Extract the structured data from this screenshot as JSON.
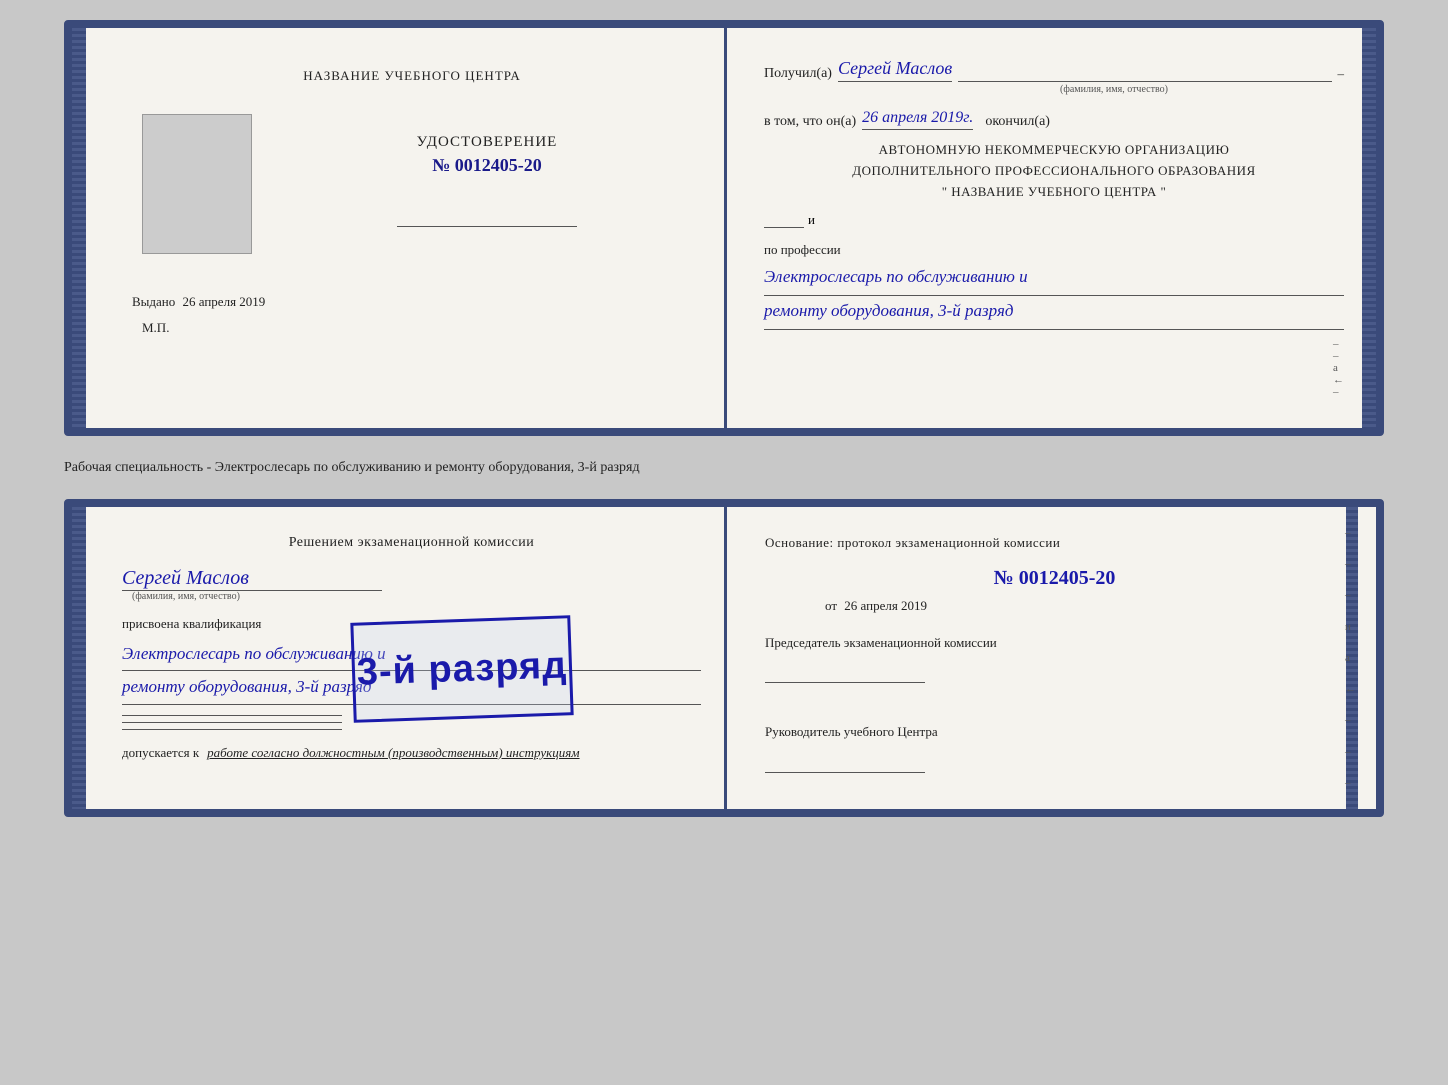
{
  "top_cert": {
    "left": {
      "center_label": "НАЗВАНИЕ УЧЕБНОГО ЦЕНТРА",
      "udostoverenie_title": "УДОСТОВЕРЕНИЕ",
      "udostoverenie_num": "№ 0012405-20",
      "vydano_label": "Выдано",
      "vydano_date": "26 апреля 2019",
      "mp": "М.П."
    },
    "right": {
      "received_prefix": "Получил(а)",
      "recipient_name": "Сергей Маслов",
      "fio_label": "(фамилия, имя, отчество)",
      "vtom_prefix": "в том, что он(а)",
      "vtom_date": "26 апреля 2019г.",
      "okончил": "окончил(а)",
      "autonomy_line1": "АВТОНОМНУЮ НЕКОММЕРЧЕСКУЮ ОРГАНИЗАЦИЮ",
      "autonomy_line2": "ДОПОЛНИТЕЛЬНОГО ПРОФЕССИОНАЛЬНОГО ОБРАЗОВАНИЯ",
      "autonomy_line3": "\"  НАЗВАНИЕ УЧЕБНОГО ЦЕНТРА  \"",
      "profession_label": "по профессии",
      "profession_text1": "Электрослесарь по обслуживанию и",
      "profession_text2": "ремонту оборудования, 3-й разряд"
    }
  },
  "separator": {
    "text": "Рабочая специальность - Электрослесарь по обслуживанию и ремонту оборудования, 3-й разряд"
  },
  "bottom_cert": {
    "left": {
      "resheniem_title": "Решением экзаменационной комиссии",
      "name": "Сергей Маслов",
      "fio_label": "(фамилия, имя, отчество)",
      "prisvoena_label": "присвоена квалификация",
      "qualification_line1": "Электрослесарь по обслуживанию и",
      "qualification_line2": "ремонту оборудования, 3-й разряд",
      "dopuskaetsya_prefix": "допускается к",
      "dopuskaetsya_text": "работе согласно должностным (производственным) инструкциям"
    },
    "right": {
      "osnovaniye": "Основание: протокол экзаменационной комиссии",
      "protocol_num": "№  0012405-20",
      "ot_label": "от",
      "ot_date": "26 апреля 2019",
      "predsedatel": "Председатель экзаменационной комиссии",
      "rukovoditel": "Руководитель учебного Центра"
    },
    "stamp": {
      "text": "3-й разряд"
    }
  }
}
